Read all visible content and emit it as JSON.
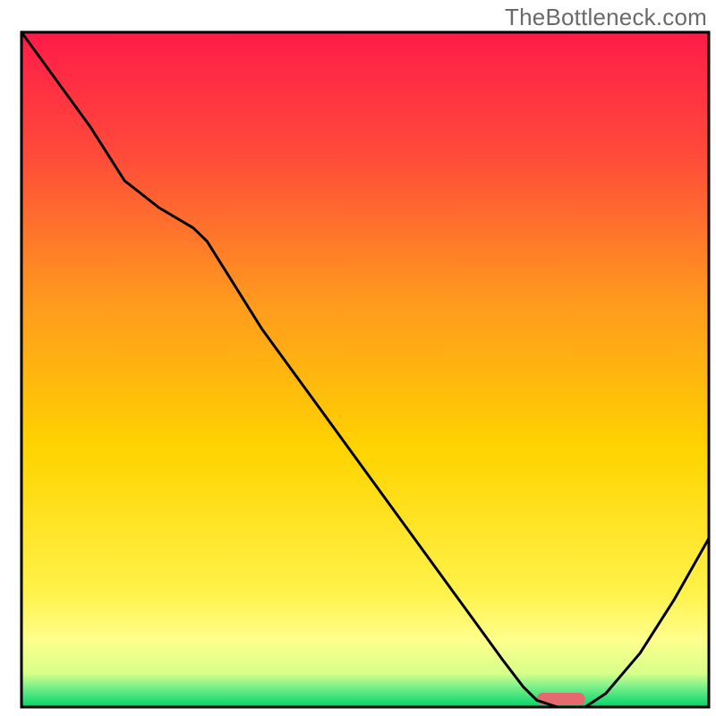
{
  "watermark": "TheBottleneck.com",
  "chart_data": {
    "type": "line",
    "title": "",
    "xlabel": "",
    "ylabel": "",
    "xlim": [
      0,
      100
    ],
    "ylim": [
      0,
      100
    ],
    "grid": false,
    "legend": false,
    "series": [
      {
        "name": "bottleneck-curve",
        "x": [
          0,
          5,
          10,
          15,
          20,
          25,
          27,
          35,
          45,
          55,
          65,
          70,
          73,
          75,
          78,
          82,
          85,
          90,
          95,
          100
        ],
        "y": [
          100,
          93,
          86,
          78,
          74,
          71,
          69,
          56,
          42,
          28,
          14,
          7,
          3,
          1,
          0,
          0,
          2,
          8,
          16,
          25
        ]
      }
    ],
    "marker": {
      "name": "optimal-range",
      "x_start": 75,
      "x_end": 82,
      "color": "#e46a6f"
    },
    "background_gradient": {
      "top": "#ff1b49",
      "mid": "#ffd400",
      "band": "#ffff8c",
      "bottom": "#00d46a"
    },
    "plot_border_color": "#000000"
  }
}
